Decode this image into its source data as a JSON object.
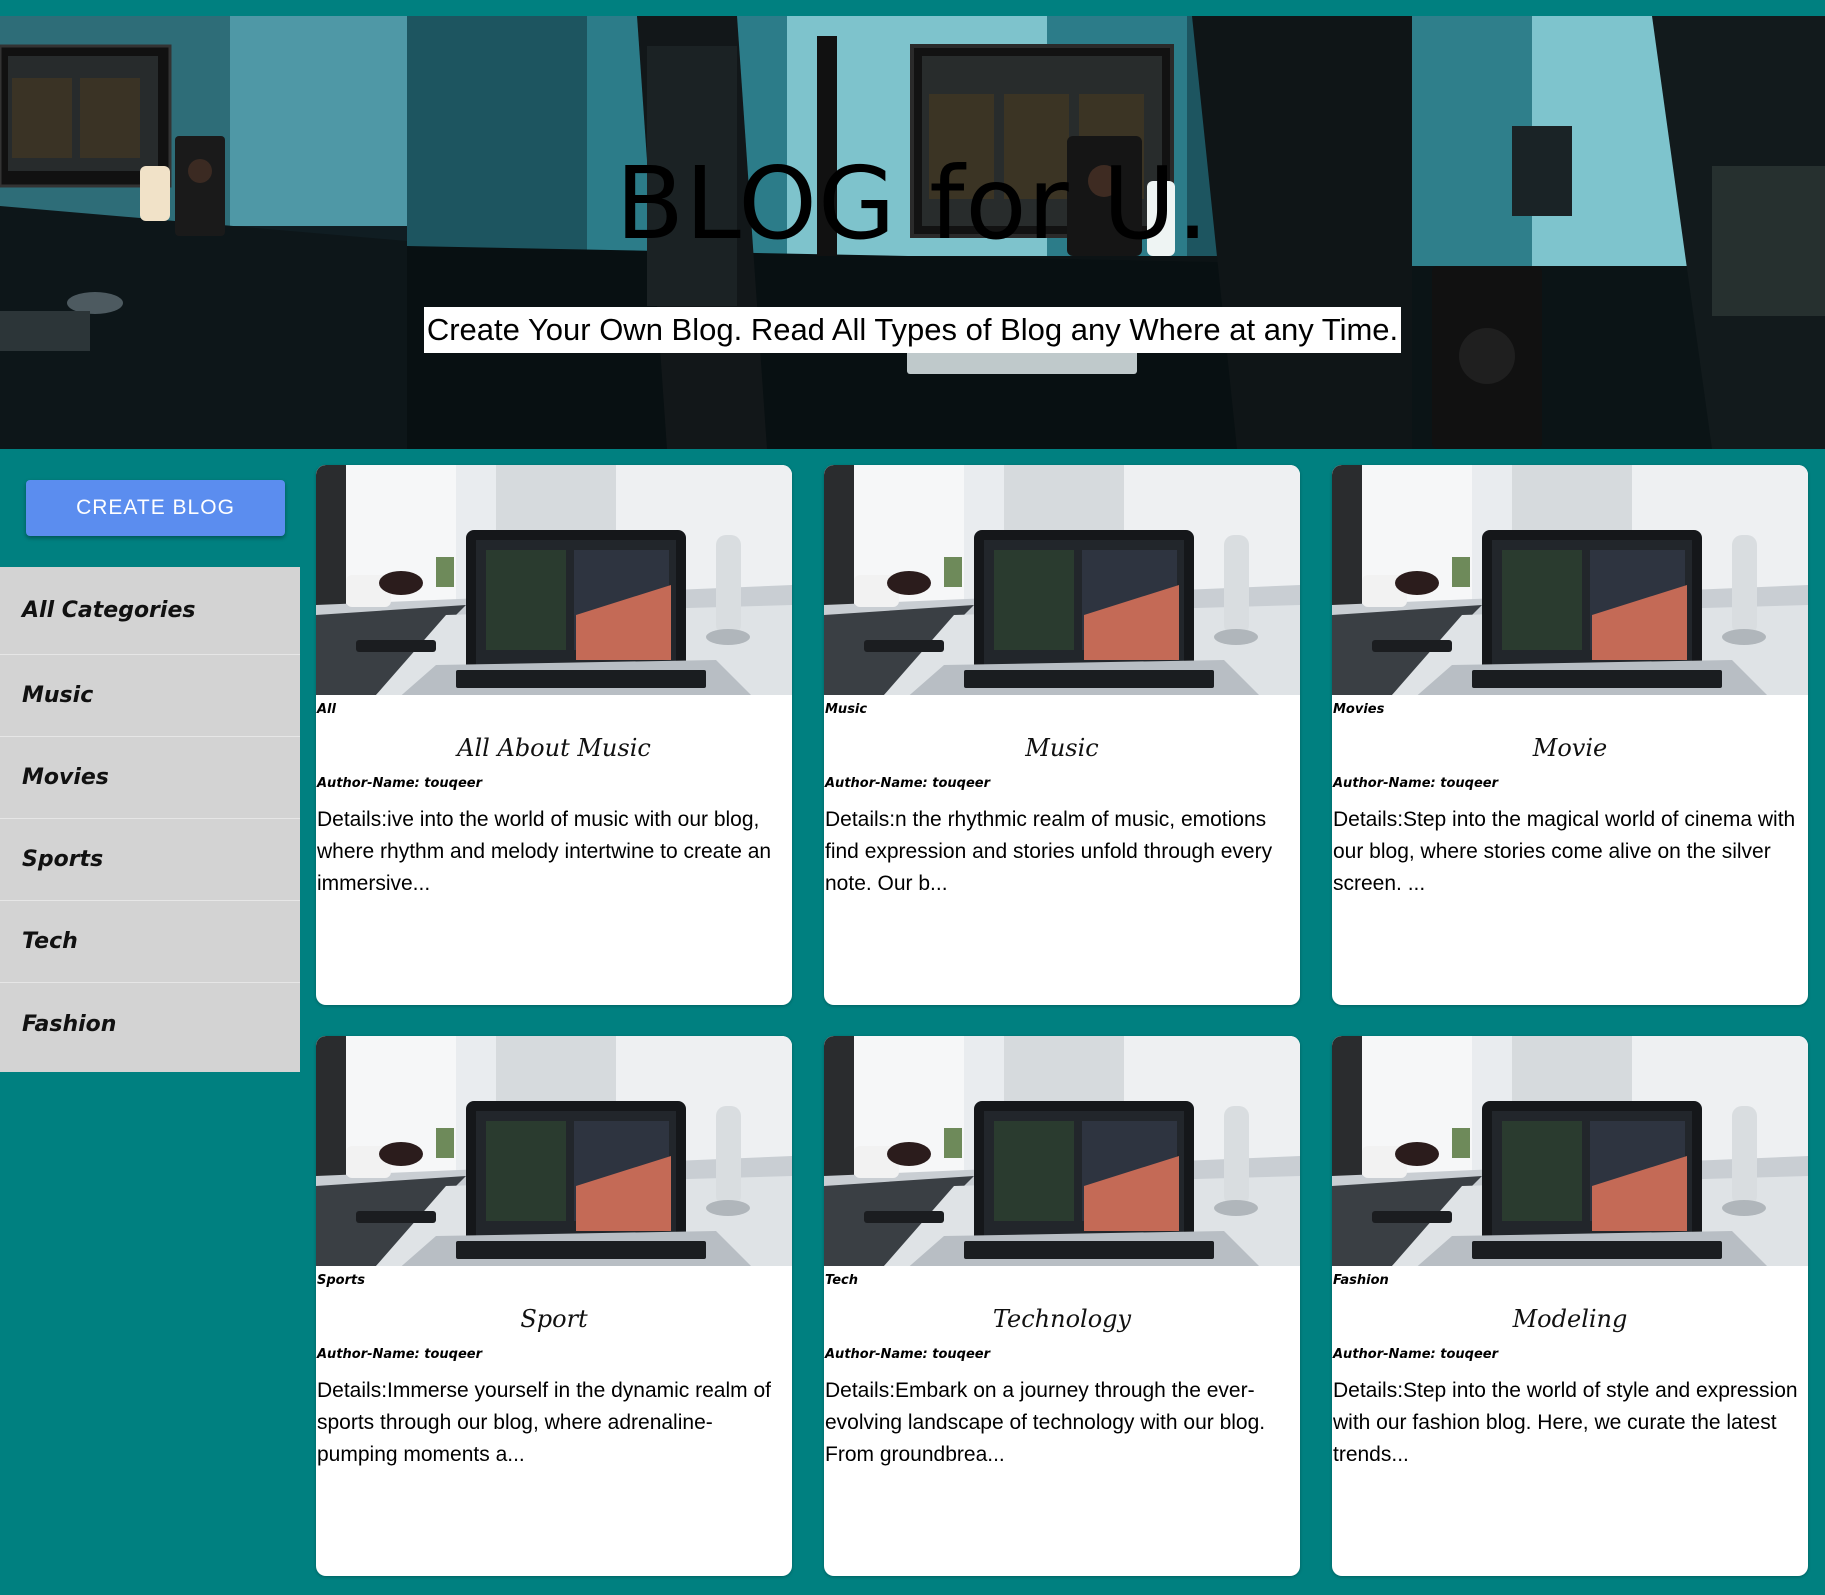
{
  "hero": {
    "title": "BLOG for U.",
    "subtitle": "Create Your Own Blog. Read All Types of Blog any Where at any Time."
  },
  "sidebar": {
    "create_button_label": "CREATE BLOG",
    "categories": [
      "All Categories",
      "Music",
      "Movies",
      "Sports",
      "Tech",
      "Fashion"
    ]
  },
  "posts": [
    {
      "category": "All",
      "title": "All About Music",
      "author": "Author-Name: touqeer",
      "details": "Details:ive into the world of music with our blog, where rhythm and melody intertwine to create an immersive..."
    },
    {
      "category": "Music",
      "title": "Music",
      "author": "Author-Name: touqeer",
      "details": "Details:n the rhythmic realm of music, emotions find expression and stories unfold through every note. Our b..."
    },
    {
      "category": "Movies",
      "title": "Movie",
      "author": "Author-Name: touqeer",
      "details": "Details:Step into the magical world of cinema with our blog, where stories come alive on the silver screen. ..."
    },
    {
      "category": "Sports",
      "title": "Sport",
      "author": "Author-Name: touqeer",
      "details": "Details:Immerse yourself in the dynamic realm of sports through our blog, where adrenaline-pumping moments a..."
    },
    {
      "category": "Tech",
      "title": "Technology",
      "author": "Author-Name: touqeer",
      "details": "Details:Embark on a journey through the ever-evolving landscape of technology with our blog. From groundbrea..."
    },
    {
      "category": "Fashion",
      "title": "Modeling",
      "author": "Author-Name: touqeer",
      "details": "Details:Step into the world of style and expression with our fashion blog. Here, we curate the latest trends..."
    }
  ],
  "colors": {
    "page_background": "#008080",
    "button": "#5b8def",
    "sidebar": "#d3d3d3"
  }
}
